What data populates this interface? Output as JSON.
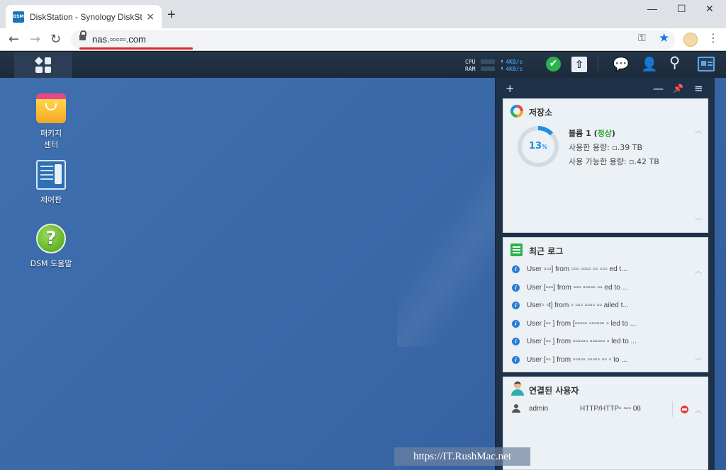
{
  "browser": {
    "tab_title": "DiskStation - Synology DiskStati",
    "favicon_text": "DSM",
    "tab_close": "×",
    "new_tab": "+",
    "win_min": "—",
    "win_max": "☐",
    "win_close": "✕",
    "back": "←",
    "forward": "→",
    "reload": "↻",
    "url": "nas.▫▫▫▫▫.com",
    "star": "★",
    "menu": "⋮"
  },
  "taskbar": {
    "cpu_label": "CPU",
    "ram_label": "RAM",
    "upload_rate": "4KB/s",
    "download_rate": "4KB/s",
    "up_arrow": "⬆",
    "down_arrow": "⬇",
    "status_check": "✔",
    "upload_glyph": "⇧"
  },
  "desktop": {
    "icons": [
      {
        "label": "패키지\n센터"
      },
      {
        "label": "제어판"
      },
      {
        "label": "DSM 도움말",
        "glyph": "?"
      }
    ]
  },
  "panel": {
    "add": "+",
    "minimize": "—",
    "pin": "📌",
    "options": "≡",
    "storage": {
      "title": "저장소",
      "percent": "13",
      "percent_unit": "%",
      "volume": "볼륨 1",
      "status_open": "(",
      "status": "정상",
      "status_close": ")",
      "used": "사용한 용량:  ▫.39 TB",
      "available": "사용 가능한 용량:  ▫.42 TB",
      "used_fraction": 0.13
    },
    "logs": {
      "title": "최근 로그",
      "entries": [
        "User ▫▫▫] from ▫▫▫ ▫▫▫▫ ▫▫ ▫▫▫ ed t...",
        "User [▫▫▫] from ▫▫▫ ▫▫▫▫▫ ▫▫ ed to ...",
        "User▫ ▫t] from ▫ ▫▫▫ ▫▫▫▫ ▫▫ ailed t...",
        "User [▫▫ ] from [▫▫▫▫▫ ▫▫▫▫▫▫ ▫ led to ...",
        "User [▫▫ ] from ▫▫▫▫▫▫ ▫▫▫▫▫▫ ▫ led to ...",
        "User [▫▫ ] from ▫▫▫▫▫ ▫▫▫▫▫ ▫▫ ▫ to ..."
      ]
    },
    "users": {
      "title": "연결된 사용자",
      "rows": [
        {
          "name": "admin",
          "protocol": "HTTP/HTTP▫ ▫▫▫ 08"
        }
      ]
    }
  },
  "watermark": "https://IT.RushMac.net"
}
